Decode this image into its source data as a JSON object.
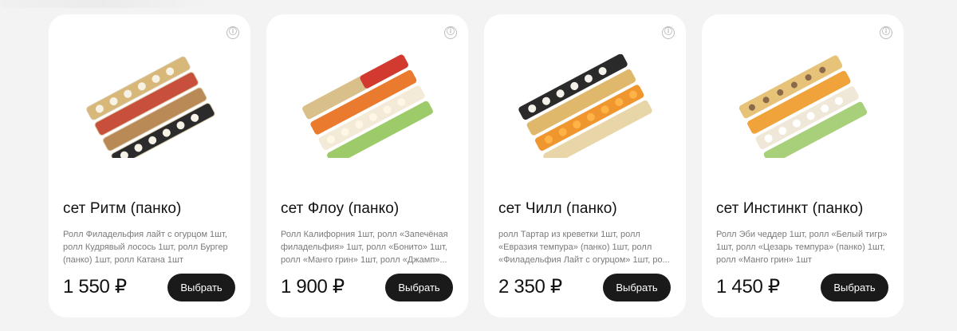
{
  "products": [
    {
      "name": "сет Ритм (панко)",
      "description": "Ролл Филадельфия лайт с огурцом 1шт, ролл Кудрявый лосось 1шт, ролл Бургер (панко) 1шт, ролл Катана 1шт",
      "price": "1 550 ₽",
      "button": "Выбрать",
      "info_icon": "ⓘ",
      "image_icon": "sushi-set-image"
    },
    {
      "name": "сет Флоу (панко)",
      "description": "Ролл Калифорния 1шт, ролл «Запечёная филадельфия» 1шт, ролл «Бонито» 1шт, ролл «Манго грин» 1шт, ролл «Джамп»...",
      "price": "1 900 ₽",
      "button": "Выбрать",
      "info_icon": "ⓘ",
      "image_icon": "sushi-set-image"
    },
    {
      "name": "сет Чилл (панко)",
      "description": "ролл Тартар из креветки 1шт, ролл «Евразия темпура» (панко) 1шт, ролл «Филадельфия Лайт с огурцом» 1шт, ро...",
      "price": "2 350 ₽",
      "button": "Выбрать",
      "info_icon": "ⓘ",
      "image_icon": "sushi-set-image"
    },
    {
      "name": "сет Инстинкт (панко)",
      "description": "Ролл Эби чеддер 1шт, ролл «Белый тигр» 1шт, ролл «Цезарь темпура» (панко) 1шт, ролл «Манго грин» 1шт",
      "price": "1 450 ₽",
      "button": "Выбрать",
      "info_icon": "ⓘ",
      "image_icon": "sushi-set-image"
    }
  ]
}
